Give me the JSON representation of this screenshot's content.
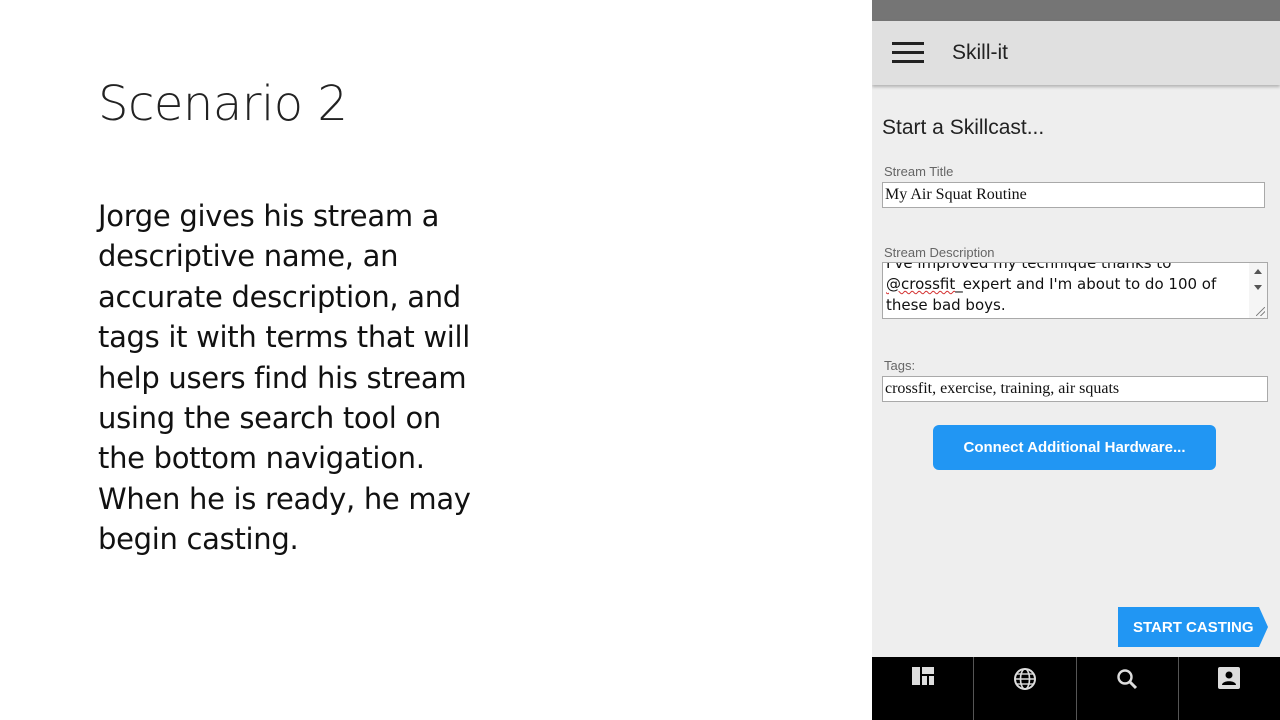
{
  "slide": {
    "title": "Scenario 2",
    "body": "Jorge gives his stream a descriptive name, an accurate description, and tags it with terms that will help users find his stream using the search tool on the bottom navigation. When he is ready, he may begin casting."
  },
  "app": {
    "title": "Skill-it",
    "menu_icon": "hamburger-menu-icon"
  },
  "form": {
    "heading": "Start a Skillcast...",
    "stream_title_label": "Stream Title",
    "stream_title_value": "My Air Squat Routine",
    "stream_description_label": "Stream Description",
    "stream_description_line1": "I've improved my technique thanks to",
    "stream_description_mention": "@crossfit",
    "stream_description_rest": "_expert and I'm about to do 100 of these bad boys.",
    "tags_label": "Tags:",
    "tags_value": "crossfit, exercise, training, air squats",
    "hardware_button": "Connect Additional Hardware...",
    "cast_button": "START CASTING"
  },
  "bottom_nav": {
    "items": [
      {
        "icon": "dashboard-icon"
      },
      {
        "icon": "globe-icon"
      },
      {
        "icon": "search-icon"
      },
      {
        "icon": "profile-icon"
      }
    ]
  },
  "colors": {
    "accent": "#2196f3",
    "app_bar": "#e0e0e0",
    "status_bar": "#757575",
    "bottom_nav": "#000000"
  }
}
